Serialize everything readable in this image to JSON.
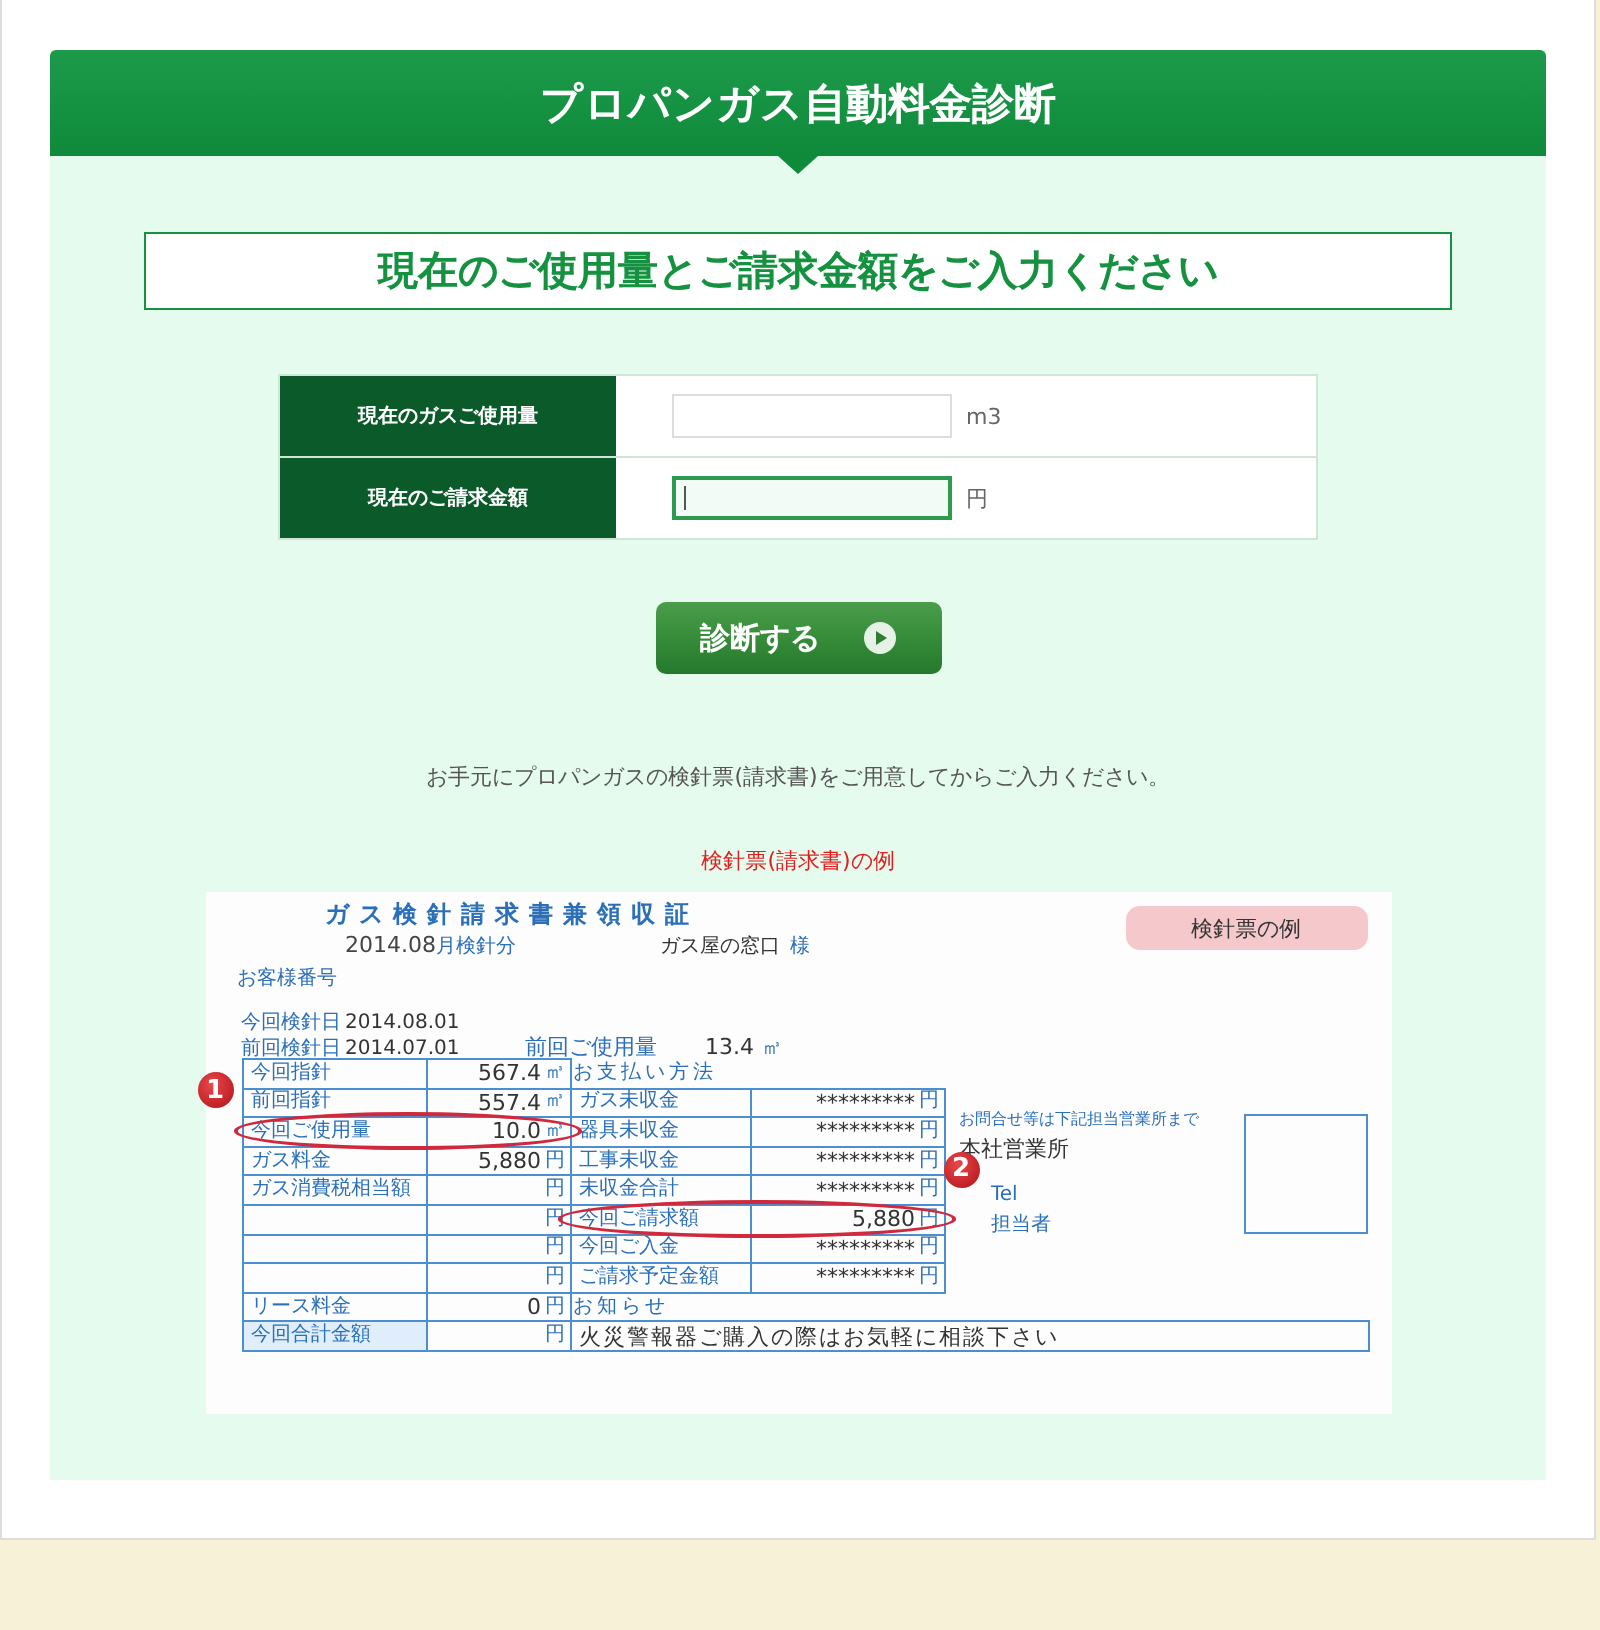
{
  "header": {
    "title": "プロパンガス自動料金診断"
  },
  "subtitle": "現在のご使用量とご請求金額をご入力ください",
  "form": {
    "rows": [
      {
        "label": "現在のガスご使用量",
        "unit": "m3",
        "focused": false
      },
      {
        "label": "現在のご請求金額",
        "unit": "円",
        "focused": true
      }
    ]
  },
  "submit_button": "診断する",
  "note": "お手元にプロパンガスの検針票(請求書)をご用意してからご入力ください。",
  "example_caption": "検針票(請求書)の例",
  "bill": {
    "title": "ガス検針請求書兼領収証",
    "period_date": "2014.08",
    "period_label": "月検針分",
    "recipient": "ガス屋の窓口",
    "honorific": "様",
    "customer_no_label": "お客様番号",
    "badge": "検針票の例",
    "reading_dates": [
      {
        "label": "今回検針日",
        "value": "2014.08.01"
      },
      {
        "label": "前回検針日",
        "value": "2014.07.01"
      }
    ],
    "previous_usage": {
      "label": "前回ご使用量",
      "value": "13.4",
      "unit": "㎥"
    },
    "left_rows": [
      {
        "label": "今回指針",
        "value": "567.4",
        "unit": "㎥",
        "circled": false
      },
      {
        "label": "前回指針",
        "value": "557.4",
        "unit": "㎥",
        "circled": false
      },
      {
        "label": "今回ご使用量",
        "value": "10.0",
        "unit": "㎥",
        "circled": true,
        "marker": "1"
      },
      {
        "label": "ガス料金",
        "value": "5,880",
        "unit": "円",
        "circled": false
      },
      {
        "label": "ガス消費税相当額",
        "unit": "円",
        "circled": false
      },
      {
        "unit": "円",
        "circled": false
      },
      {
        "unit": "円",
        "circled": false
      },
      {
        "unit": "円",
        "circled": false
      },
      {
        "label": "リース料金",
        "value": "0",
        "unit": "円",
        "circled": false
      },
      {
        "label": "今回合計金額",
        "unit": "円",
        "circled": false
      }
    ],
    "payment_label": "お支払い方法",
    "right_rows": [
      {
        "label": "ガス未収金",
        "value": "*********",
        "unit": "円",
        "circled": false
      },
      {
        "label": "器具未収金",
        "value": "*********",
        "unit": "円",
        "circled": false
      },
      {
        "label": "工事未収金",
        "value": "*********",
        "unit": "円",
        "circled": false
      },
      {
        "label": "未収金合計",
        "value": "*********",
        "unit": "円",
        "circled": false
      },
      {
        "label": "今回ご請求額",
        "value": "5,880",
        "unit": "円",
        "circled": true,
        "marker": "2"
      },
      {
        "label": "今回ご入金",
        "value": "*********",
        "unit": "円",
        "circled": false
      },
      {
        "label": "ご請求予定金額",
        "value": "*********",
        "unit": "円",
        "circled": false
      }
    ],
    "notice_label": "お知らせ",
    "notice": "火災警報器ご購入の際はお気軽に相談下さい",
    "contact_note": "お問合せ等は下記担当営業所まで",
    "office": "本社営業所",
    "tel_label": "Tel",
    "staff_label": "担当者"
  }
}
